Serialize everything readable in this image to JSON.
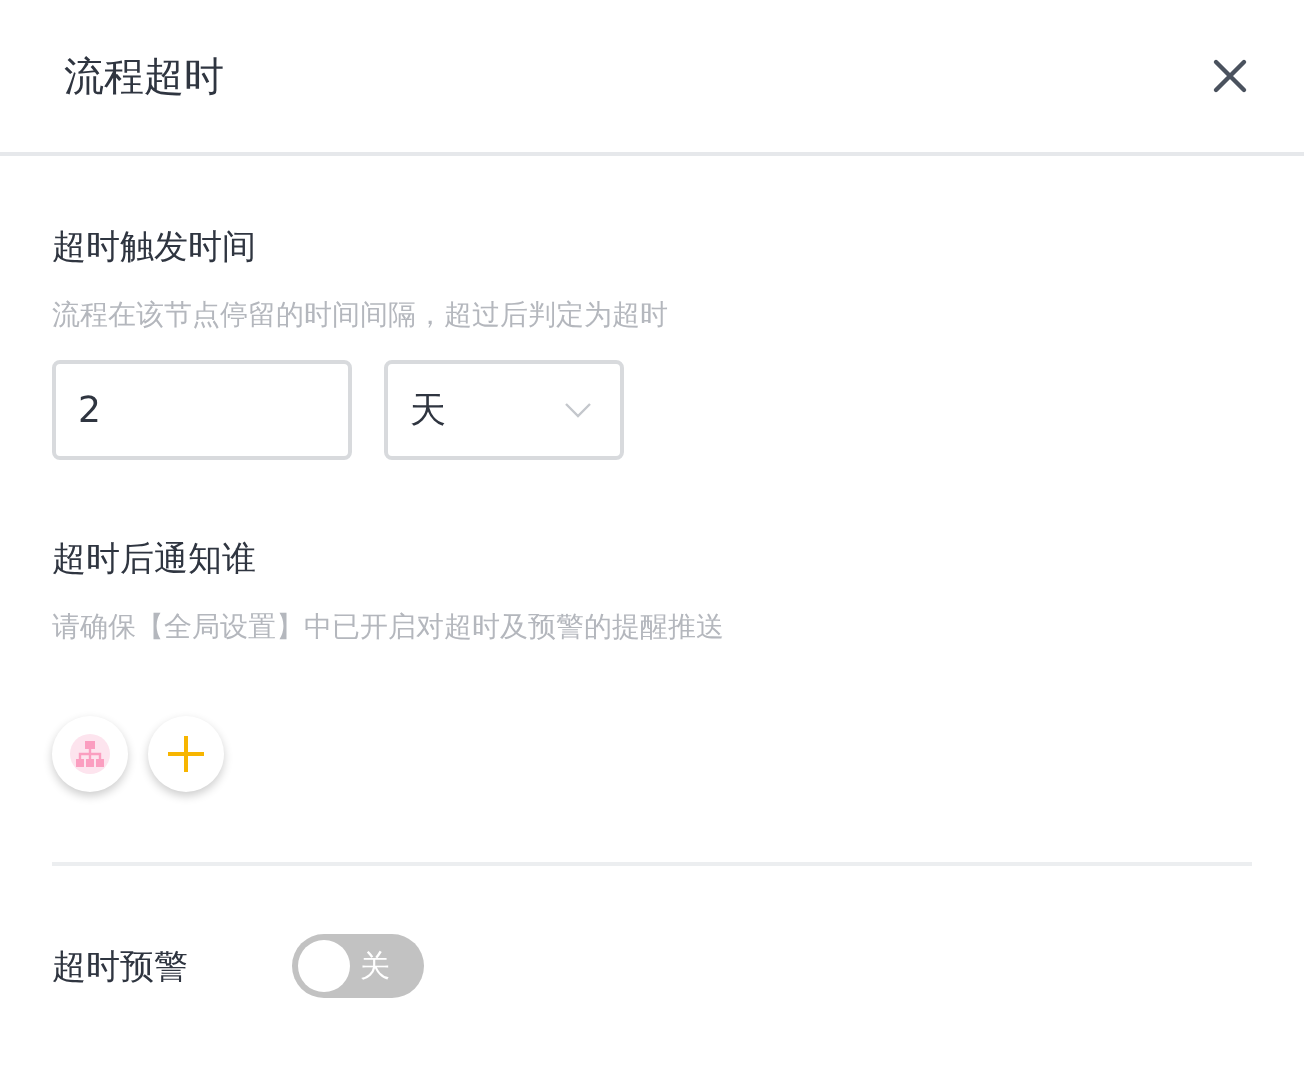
{
  "dialog": {
    "title": "流程超时"
  },
  "trigger": {
    "label": "超时触发时间",
    "hint": "流程在该节点停留的时间间隔，超过后判定为超时",
    "value": "2",
    "unit": "天"
  },
  "notify": {
    "label": "超时后通知谁",
    "hint": "请确保【全局设置】中已开启对超时及预警的提醒推送"
  },
  "warning": {
    "label": "超时预警",
    "on": false,
    "switch_text": "关"
  }
}
